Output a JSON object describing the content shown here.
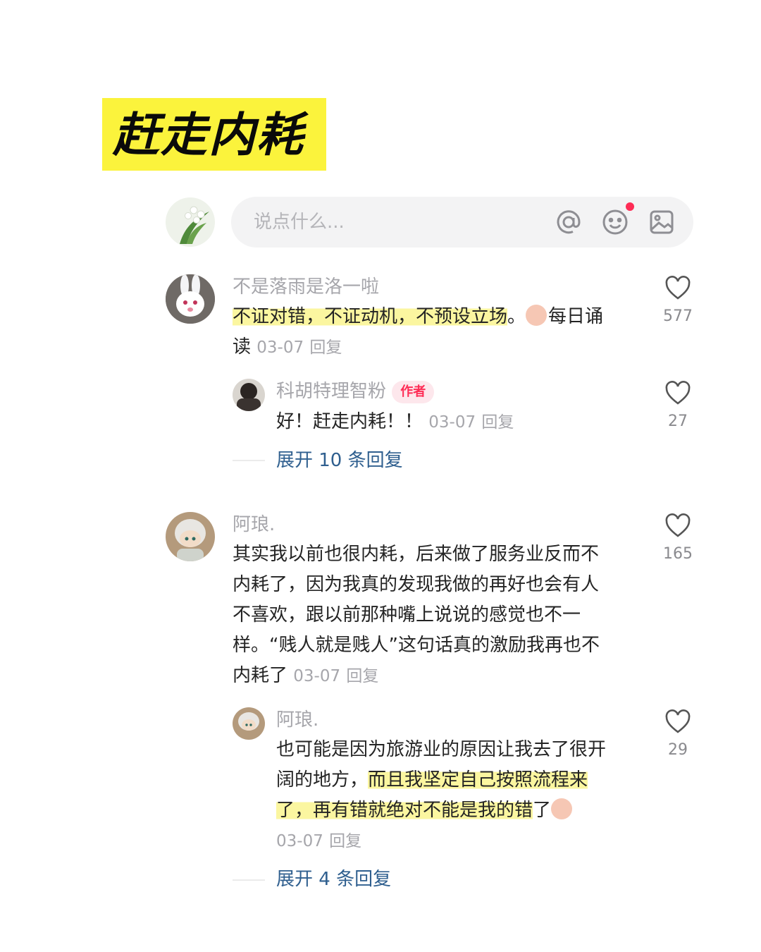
{
  "title": "赶走内耗",
  "input_bar": {
    "placeholder": "说点什么...",
    "icons": [
      "at-icon",
      "emoji-icon",
      "image-icon"
    ]
  },
  "colors": {
    "title_highlight": "#fbf33c",
    "text_highlight": "#fbf6a0",
    "author_tag": "#fe2c55",
    "expand_link": "#2f5f8f"
  },
  "comments": [
    {
      "username": "不是落雨是洛一啦",
      "text_highlight": "不证对错，不证动机，不预设立场",
      "text_after": "。",
      "emoji_label": "每日诵",
      "text_line2": "读",
      "date": "03-07",
      "reply_label": "回复",
      "likes": "577",
      "reply": {
        "username": "科胡特理智粉",
        "author_tag": "作者",
        "text": "好！赶走内耗！！",
        "date": "03-07",
        "reply_label": "回复",
        "likes": "27"
      },
      "expand": "展开 10 条回复"
    },
    {
      "username": "阿琅.",
      "lines": [
        "其实我以前也很内耗，后来做了服务业反而不",
        "内耗了，因为我真的发现我做的再好也会有人",
        "不喜欢，跟以前那种嘴上说说的感觉也不一",
        "样。“贱人就是贱人”这句话真的激励我再也不",
        "内耗了"
      ],
      "date": "03-07",
      "reply_label": "回复",
      "likes": "165",
      "reply": {
        "username": "阿琅.",
        "line1": "也可能是因为旅游业的原因让我去了很开",
        "line2_plain": "阔的地方，",
        "line2_highlight": "而且我坚定自己按照流程来",
        "line3_highlight": "了，再有错就绝对不能是我的错",
        "line3_after": "了",
        "date": "03-07",
        "reply_label": "回复",
        "likes": "29"
      },
      "expand": "展开 4 条回复"
    }
  ]
}
